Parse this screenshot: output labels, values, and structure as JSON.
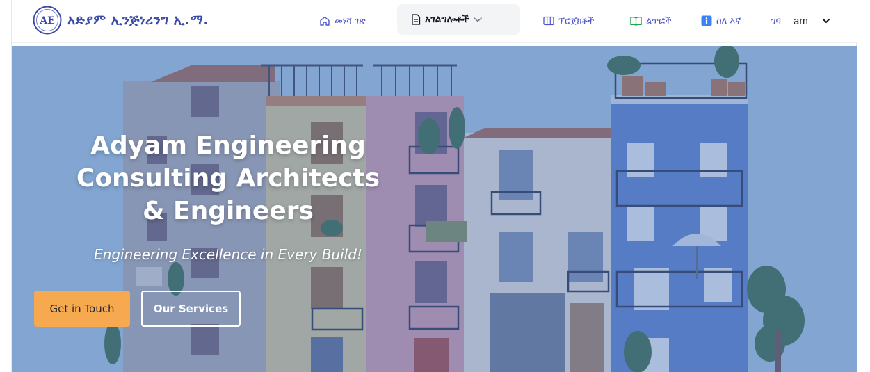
{
  "brand": {
    "name": "አድያም ኢንጅነሪንግ ኢ.ማ.",
    "logo_text": "AE"
  },
  "nav": {
    "home": "መነሻ ገጽ",
    "services": "አገልግሎቶች",
    "projects": "ፕሮጀክቶች",
    "news": "ልጥፎች",
    "about": "ስለ እኛ",
    "login": "ግባ",
    "language": "am"
  },
  "hero": {
    "title": "Adyam Engineering Consulting Architects & Engineers",
    "tagline": "Engineering Excellence in Every Build!",
    "primary_button": "Get in Touch",
    "secondary_button": "Our Services"
  },
  "colors": {
    "accent": "#f6a94e",
    "nav_link": "#4f55c9",
    "brand": "#3b4aa8",
    "hero_sky": "#94b9dc"
  },
  "icons": [
    "home-icon",
    "document-icon",
    "chevron-down-icon",
    "columns-icon",
    "book-icon",
    "info-icon"
  ]
}
